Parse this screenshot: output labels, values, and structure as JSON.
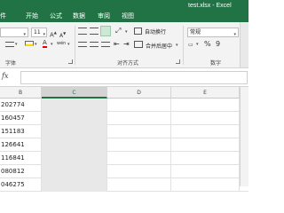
{
  "tabs": [
    "件",
    "开始",
    "公式",
    "数据",
    "审阅",
    "视图"
  ],
  "title": "test.xlsx - Excel",
  "font": {
    "size": "11",
    "group_label": "字体",
    "grow_glyph": "A",
    "shrink_glyph": "A",
    "phonetic_glyph": "wén"
  },
  "alignment": {
    "wrap_text_label": "自动换行",
    "merge_center_label": "合并后居中",
    "group_label": "对齐方式"
  },
  "number": {
    "format": "常规",
    "percent_glyph": "%",
    "comma_glyph": "9",
    "group_label": "数字"
  },
  "formula_bar": {
    "fx": "fx",
    "value": ""
  },
  "grid": {
    "columns": [
      "B",
      "C",
      "D",
      "E"
    ],
    "selected_column": "C",
    "rows": [
      "202774",
      "160457",
      "151183",
      "126641",
      "116841",
      "080812",
      "046275"
    ]
  },
  "colors": {
    "accent": "#217346"
  }
}
